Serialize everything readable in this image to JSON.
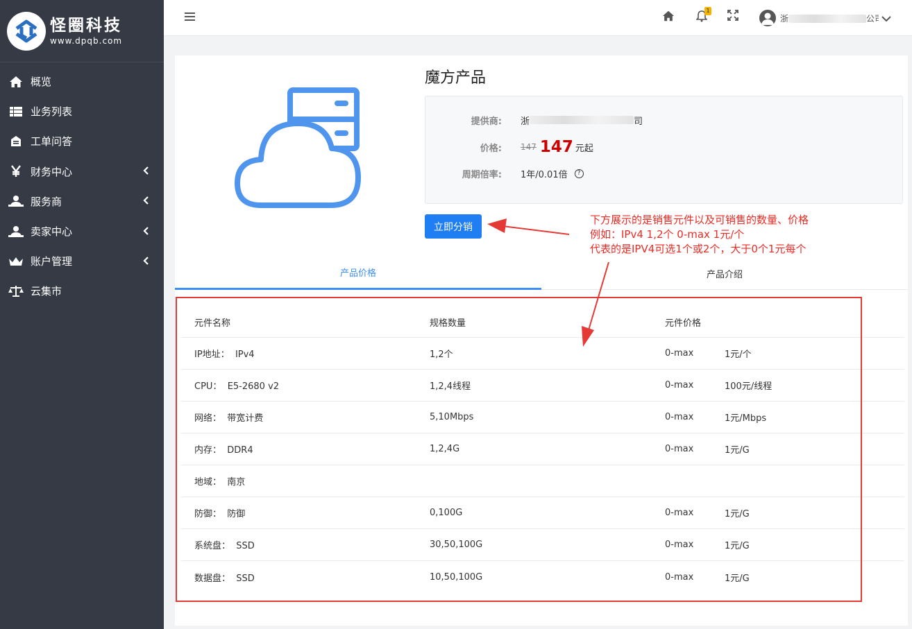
{
  "brand": {
    "title": "怪圈科技",
    "subtitle": "www.dpqb.com"
  },
  "sidebar": {
    "items": [
      {
        "label": "概览",
        "icon": "home-icon",
        "has_submenu": false
      },
      {
        "label": "业务列表",
        "icon": "list-icon",
        "has_submenu": false
      },
      {
        "label": "工单问答",
        "icon": "ticket-icon",
        "has_submenu": false
      },
      {
        "label": "财务中心",
        "icon": "yen-icon",
        "has_submenu": true
      },
      {
        "label": "服务商",
        "icon": "provider-icon",
        "has_submenu": true
      },
      {
        "label": "卖家中心",
        "icon": "seller-icon",
        "has_submenu": true
      },
      {
        "label": "账户管理",
        "icon": "crown-icon",
        "has_submenu": true
      },
      {
        "label": "云集市",
        "icon": "scale-icon",
        "has_submenu": false
      }
    ]
  },
  "header": {
    "notification_count": "1",
    "user_name_prefix": "浙",
    "user_name_suffix": "公司"
  },
  "product": {
    "title": "魔方产品",
    "provider_label": "提供商:",
    "provider_prefix": "浙",
    "provider_suffix": "司",
    "price_label": "价格:",
    "original_price": "147",
    "price": "147",
    "price_unit": "元起",
    "cycle_label": "周期倍率:",
    "cycle_value": "1年/0.01倍",
    "distribute_button": "立即分销"
  },
  "annotation": {
    "lines": [
      "下方展示的是销售元件以及可销售的数量、价格",
      "例如：IPv4 1,2个 0-max 1元/个",
      "代表的是IPV4可选1个或2个，大于0个1元每个"
    ],
    "color": "#ee2a24"
  },
  "tabs": [
    {
      "label": "产品价格",
      "active": true
    },
    {
      "label": "产品介绍",
      "active": false
    }
  ],
  "table": {
    "headers": [
      "元件名称",
      "规格数量",
      "元件价格"
    ],
    "rows": [
      {
        "name": "IP地址：  IPv4",
        "spec": "1,2个",
        "range": "0-max",
        "price": "1元/个"
      },
      {
        "name": "CPU：  E5-2680 v2",
        "spec": "1,2,4线程",
        "range": "0-max",
        "price": "100元/线程"
      },
      {
        "name": "网络：  带宽计费",
        "spec": "5,10Mbps",
        "range": "0-max",
        "price": "1元/Mbps"
      },
      {
        "name": "内存：  DDR4",
        "spec": "1,2,4G",
        "range": "0-max",
        "price": "1元/G"
      },
      {
        "name": "地域：  南京",
        "spec": "",
        "range": "",
        "price": ""
      },
      {
        "name": "防御：  防御",
        "spec": "0,100G",
        "range": "0-max",
        "price": "1元/G"
      },
      {
        "name": "系统盘：  SSD",
        "spec": "30,50,100G",
        "range": "0-max",
        "price": "1元/G"
      },
      {
        "name": "数据盘：  SSD",
        "spec": "10,50,100G",
        "range": "0-max",
        "price": "1元/G"
      }
    ]
  },
  "colors": {
    "sidebar_bg": "#353a45",
    "accent": "#1e7ef2",
    "price_red": "#cc0000",
    "highlight_red": "#e53935"
  }
}
